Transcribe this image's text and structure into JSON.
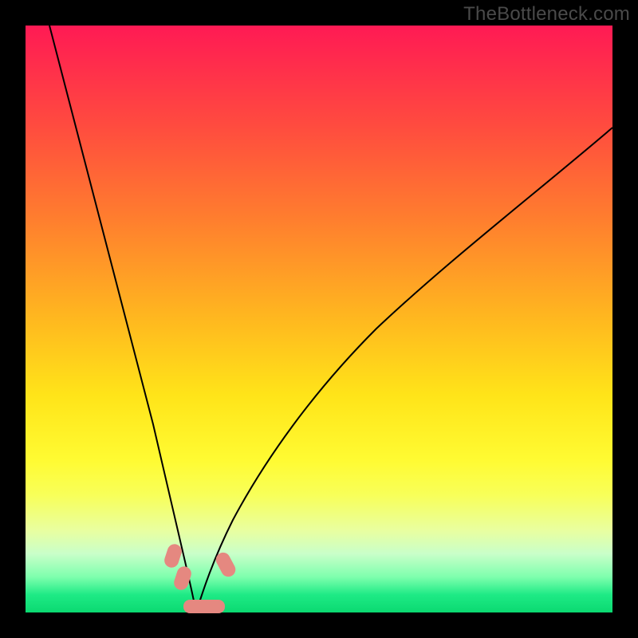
{
  "watermark": "TheBottleneck.com",
  "colors": {
    "page_bg": "#000000",
    "curve": "#000000",
    "marker": "#e58880",
    "gradient_top": "#ff1a54",
    "gradient_bottom": "#0bd971"
  },
  "chart_data": {
    "type": "line",
    "title": "",
    "xlabel": "",
    "ylabel": "",
    "xlim": [
      0,
      100
    ],
    "ylim": [
      0,
      100
    ],
    "notes": "No axes, ticks, or numeric labels are rendered; values below are estimated from pixel positions within the 736×736 plot area. y=0 is the top edge (red), y=100 is the bottom edge (green). The two curves meet near the bottom around x≈28.",
    "series": [
      {
        "name": "left-curve",
        "x": [
          4,
          8,
          12,
          16,
          20,
          22,
          24,
          26,
          27,
          28,
          29
        ],
        "y": [
          0,
          19,
          37,
          54,
          72,
          80,
          87,
          92,
          95,
          98,
          100
        ]
      },
      {
        "name": "right-curve",
        "x": [
          29,
          30,
          32,
          35,
          38,
          42,
          48,
          55,
          63,
          72,
          82,
          92,
          100
        ],
        "y": [
          100,
          98,
          93,
          87,
          81,
          73,
          63,
          54,
          45,
          37,
          29,
          22,
          17
        ]
      }
    ],
    "markers": [
      {
        "name": "pink-marker-left-upper",
        "x": 25.0,
        "y": 90.0
      },
      {
        "name": "pink-marker-left-lower",
        "x": 26.5,
        "y": 94.0
      },
      {
        "name": "pink-marker-bottom",
        "x": 29.0,
        "y": 99.5
      },
      {
        "name": "pink-marker-right",
        "x": 34.0,
        "y": 91.5
      }
    ]
  }
}
